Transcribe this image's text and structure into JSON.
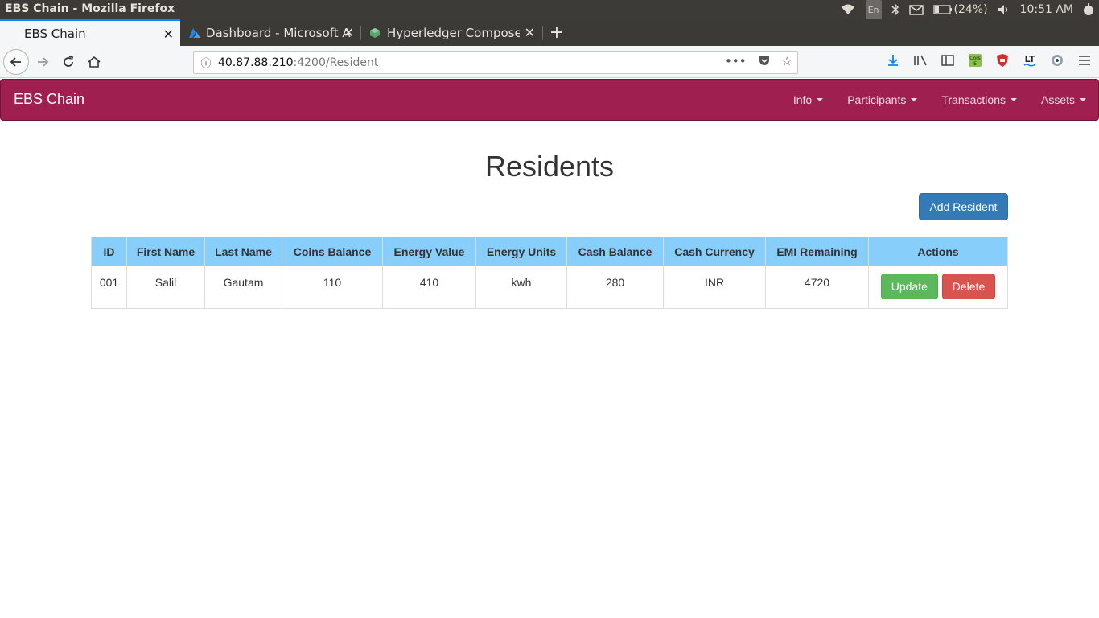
{
  "os": {
    "window_title": "EBS Chain - Mozilla Firefox",
    "keyboard": "En",
    "battery": "(24%)",
    "clock": "10:51 AM"
  },
  "tabs": [
    {
      "label": "EBS Chain",
      "active": true
    },
    {
      "label": "Dashboard - Microsoft A",
      "active": false
    },
    {
      "label": "Hyperledger Composer",
      "active": false
    }
  ],
  "url": {
    "host": "40.87.88.210",
    "rest": ":4200/Resident"
  },
  "app": {
    "brand": "EBS Chain",
    "menu": [
      "Info",
      "Participants",
      "Transactions",
      "Assets"
    ],
    "page_title": "Residents",
    "add_label": "Add Resident"
  },
  "table": {
    "headers": [
      "ID",
      "First Name",
      "Last Name",
      "Coins Balance",
      "Energy Value",
      "Energy Units",
      "Cash Balance",
      "Cash Currency",
      "EMI Remaining",
      "Actions"
    ],
    "rows": [
      {
        "id": "001",
        "first": "Salil",
        "last": "Gautam",
        "coins": "110",
        "energy_value": "410",
        "energy_units": "kwh",
        "cash": "280",
        "currency": "INR",
        "emi": "4720",
        "update_label": "Update",
        "delete_label": "Delete"
      }
    ]
  },
  "colors": {
    "navbar": "#9f1f50",
    "table_header": "#87cefa",
    "primary": "#337ab7",
    "success": "#5cb85c",
    "danger": "#d9534f"
  }
}
